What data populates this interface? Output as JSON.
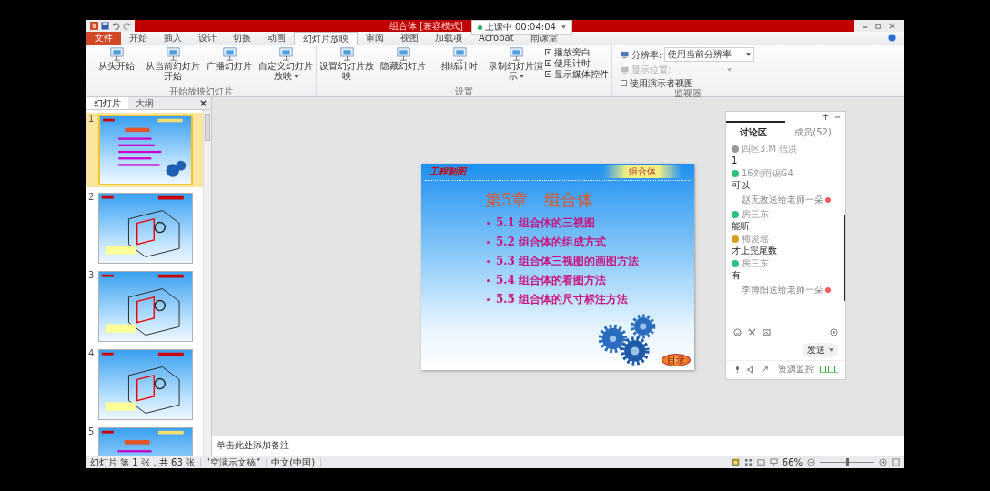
{
  "titlebar": {
    "title": "组合体 [兼容模式]"
  },
  "recording": {
    "status": "上课中",
    "time": "00:04:04"
  },
  "ribbon_tabs": [
    {
      "label": "文件",
      "kind": "file",
      "selected": false
    },
    {
      "label": "开始",
      "kind": "tab",
      "selected": false
    },
    {
      "label": "插入",
      "kind": "tab",
      "selected": false
    },
    {
      "label": "设计",
      "kind": "tab",
      "selected": false
    },
    {
      "label": "切换",
      "kind": "tab",
      "selected": false
    },
    {
      "label": "动画",
      "kind": "tab",
      "selected": false
    },
    {
      "label": "幻灯片放映",
      "kind": "tab",
      "selected": true
    },
    {
      "label": "审阅",
      "kind": "tab",
      "selected": false
    },
    {
      "label": "视图",
      "kind": "tab",
      "selected": false
    },
    {
      "label": "加载项",
      "kind": "tab",
      "selected": false
    },
    {
      "label": "Acrobat",
      "kind": "tab",
      "selected": false
    },
    {
      "label": "雨课堂",
      "kind": "tab",
      "selected": false
    }
  ],
  "ribbon_groups": [
    {
      "name": "开始放映幻灯片",
      "buttons": [
        {
          "label": "从头开始",
          "dropdown": false
        },
        {
          "label": "从当前幻灯片开始",
          "dropdown": false
        },
        {
          "label": "广播幻灯片",
          "dropdown": false
        },
        {
          "label": "自定义幻灯片放映",
          "dropdown": true
        }
      ]
    },
    {
      "name": "设置",
      "buttons": [
        {
          "label": "设置幻灯片放映",
          "dropdown": false
        },
        {
          "label": "隐藏幻灯片",
          "dropdown": false
        },
        {
          "label": "排练计时",
          "dropdown": false
        },
        {
          "label": "录制幻灯片演示",
          "dropdown": true
        }
      ],
      "checkboxes": [
        {
          "label": "播放旁白",
          "checked": true
        },
        {
          "label": "使用计时",
          "checked": true
        },
        {
          "label": "显示媒体控件",
          "checked": true
        }
      ]
    }
  ],
  "monitor_group": {
    "name": "监视器",
    "resolution_label": "分辨率:",
    "resolution_value": "使用当前分辨率",
    "position_label": "显示位置:",
    "position_disabled": true,
    "presenter_view": {
      "label": "使用演示者视图",
      "checked": false
    }
  },
  "slide_panel": {
    "tabs": [
      {
        "label": "幻灯片",
        "selected": true
      },
      {
        "label": "大纲",
        "selected": false
      }
    ],
    "thumbnails": [
      {
        "number": "1",
        "kind": "title",
        "selected": true
      },
      {
        "number": "2",
        "kind": "drawing",
        "selected": false
      },
      {
        "number": "3",
        "kind": "drawing",
        "selected": false
      },
      {
        "number": "4",
        "kind": "drawing",
        "selected": false
      },
      {
        "number": "5",
        "kind": "title",
        "selected": false
      }
    ]
  },
  "slide": {
    "header": "工程制图",
    "band": "组合体",
    "title": "第5章　组合体",
    "items": [
      {
        "number": "5.1",
        "text": "组合体的三视图"
      },
      {
        "number": "5.2",
        "text": "组合体的组成方式"
      },
      {
        "number": "5.3",
        "text": "组合体三视图的画图方法"
      },
      {
        "number": "5.4",
        "text": "组合体的看图方法"
      },
      {
        "number": "5.5",
        "text": "组合体的尺寸标注方法"
      }
    ],
    "button": "目录"
  },
  "notes": {
    "placeholder": "单击此处添加备注"
  },
  "status_bar": {
    "slide_info": "幻灯片 第 1 张，共 63 张",
    "theme": "“空演示文稿”",
    "language": "中文(中国)",
    "zoom": "66%",
    "zoom_level": {
      "level": 0.5
    }
  },
  "chat": {
    "tabs": [
      {
        "label": "讨论区",
        "selected": true
      },
      {
        "label": "成员(52)",
        "selected": false
      }
    ],
    "messages": [
      {
        "kind": "user",
        "name": "四区3.M 信洪",
        "text": "1",
        "color": "#9a9a9a"
      },
      {
        "kind": "user",
        "name": "16刘雨锡G4",
        "text": "可以",
        "color": "#2ec27e"
      },
      {
        "kind": "gift",
        "text": "赵无敌送给老师一朵"
      },
      {
        "kind": "user",
        "name": "房三东",
        "text": "能听",
        "color": "#2ec27e"
      },
      {
        "kind": "user",
        "name": "梅浚瑶",
        "text": "才上完尾数",
        "color": "#d4a017"
      },
      {
        "kind": "user",
        "name": "房三东",
        "text": "有",
        "color": "#2ec27e"
      },
      {
        "kind": "gift",
        "text": "李博阳送给老师一朵"
      }
    ],
    "send": "发送",
    "monitor": "资源监控"
  }
}
